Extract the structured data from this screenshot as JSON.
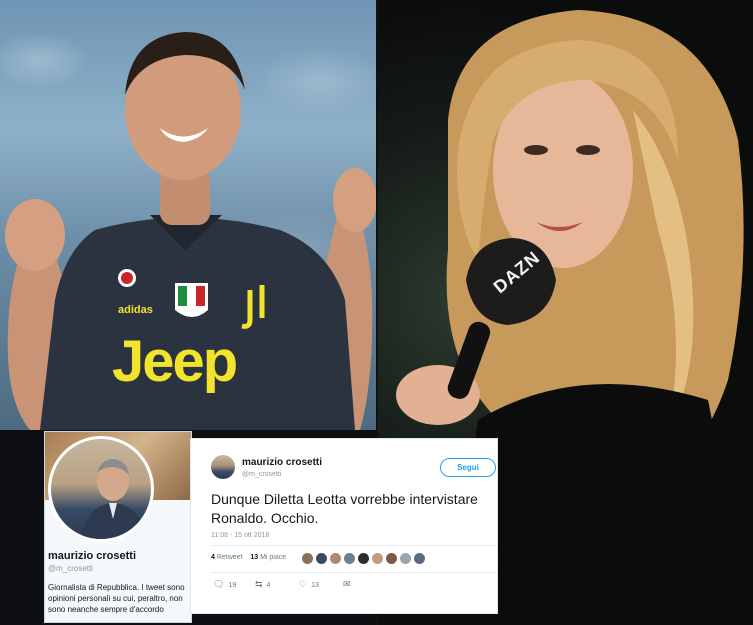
{
  "profile": {
    "name": "maurizio crosetti",
    "handle": "@m_crosetti",
    "bio": "Giornalista di Repubblica. I tweet sono opinioni personali su cui, peraltro, non sono neanche sempre d'accordo"
  },
  "tweet": {
    "author_name": "maurizio crosetti",
    "author_handle": "@m_crosetti",
    "follow_label": "Segui",
    "text": "Dunque Diletta Leotta vorrebbe intervistare Ronaldo. Occhio.",
    "timestamp": "11:08 - 15 ott 2018",
    "retweets_count": "4",
    "retweets_label": "Retweet",
    "likes_count": "13",
    "likes_label": "Mi piace",
    "liker_colors": [
      "#8a6f5a",
      "#3c4a5e",
      "#b08a70",
      "#6d7f93",
      "#2d2d2d",
      "#c49a7c",
      "#7a5a48",
      "#9aa5b0",
      "#5b6c80"
    ],
    "actions": {
      "reply_count": "19",
      "retweet_count": "4",
      "like_count": "13"
    }
  },
  "photos": {
    "jersey_brand": "Jeep",
    "microphone_brand": "DAZN"
  },
  "colors": {
    "twitter_blue": "#1da1f2",
    "jersey": "#2b3340",
    "jersey_accent": "#f2e32c"
  }
}
